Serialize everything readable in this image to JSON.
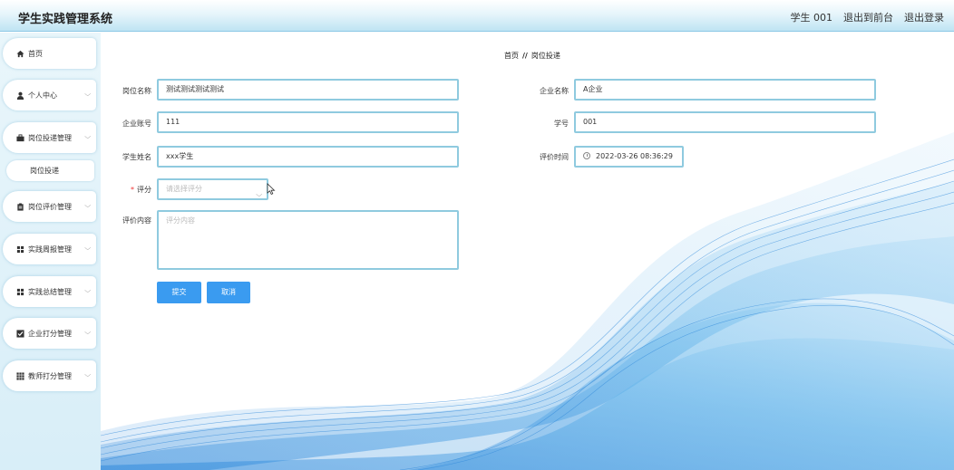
{
  "header": {
    "title": "学生实践管理系统",
    "user": "学生 001",
    "exit_front": "退出到前台",
    "logout": "退出登录"
  },
  "sidebar": {
    "items": [
      {
        "label": "首页",
        "icon": "home-icon",
        "expandable": false
      },
      {
        "label": "个人中心",
        "icon": "user-icon",
        "expandable": true
      },
      {
        "label": "岗位投递管理",
        "icon": "briefcase-icon",
        "expandable": true
      },
      {
        "label": "岗位评价管理",
        "icon": "clipboard-icon",
        "expandable": true
      },
      {
        "label": "实践周报管理",
        "icon": "grid-icon",
        "expandable": true
      },
      {
        "label": "实践总结管理",
        "icon": "grid-icon",
        "expandable": true
      },
      {
        "label": "企业打分管理",
        "icon": "checkbox-icon",
        "expandable": true
      },
      {
        "label": "教师打分管理",
        "icon": "grid-icon",
        "expandable": true
      }
    ],
    "subitem": "岗位投递"
  },
  "breadcrumb": {
    "home": "首页",
    "sep": "//",
    "current": "岗位投递"
  },
  "form": {
    "job_name": {
      "label": "岗位名称",
      "value": "测试测试测试测试"
    },
    "company_name": {
      "label": "企业名称",
      "value": "A企业"
    },
    "company_account": {
      "label": "企业账号",
      "value": "111"
    },
    "student_id": {
      "label": "学号",
      "value": "001"
    },
    "student_name": {
      "label": "学生姓名",
      "value": "xxx学生"
    },
    "eval_time": {
      "label": "评价时间",
      "value": "2022-03-26 08:36:29"
    },
    "score": {
      "label": "评分",
      "required_mark": "*",
      "placeholder": "请选择评分"
    },
    "content": {
      "label": "评价内容",
      "placeholder": "评分内容"
    }
  },
  "buttons": {
    "submit": "提交",
    "cancel": "取消"
  },
  "colors": {
    "accent": "#3a9bf0",
    "input_border": "#8fcadf",
    "sidebar_bg": "#d8eef8"
  }
}
